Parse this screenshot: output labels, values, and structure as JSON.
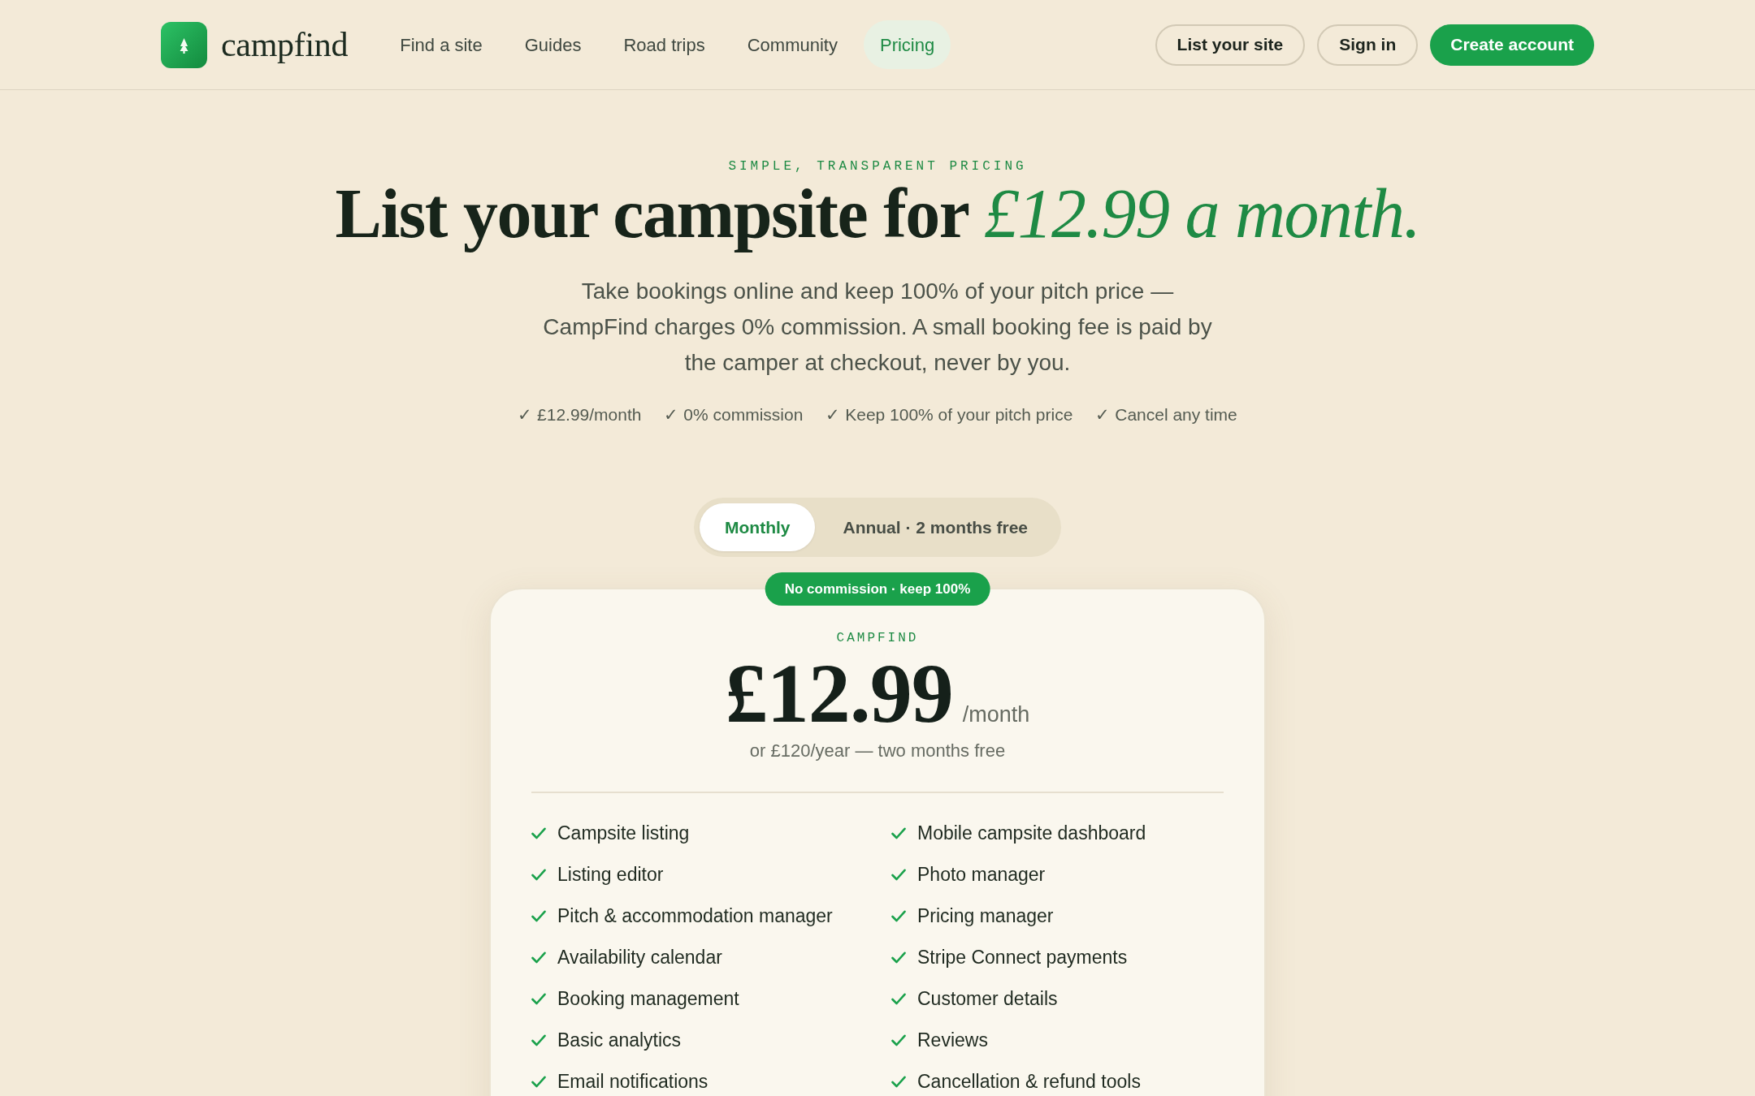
{
  "nav": {
    "logo": "campfind",
    "links": [
      {
        "label": "Find a site",
        "selected": false
      },
      {
        "label": "Guides",
        "selected": false
      },
      {
        "label": "Road trips",
        "selected": false
      },
      {
        "label": "Community",
        "selected": false
      },
      {
        "label": "Pricing",
        "selected": true
      }
    ],
    "actions": [
      {
        "label": "List your site",
        "kind": "outline"
      },
      {
        "label": "Sign in",
        "kind": "outline"
      },
      {
        "label": "Create account",
        "kind": "primary"
      }
    ]
  },
  "hero": {
    "eyebrow": "SIMPLE, TRANSPARENT PRICING",
    "heading": "List your campsite for *£12.99 a month.*",
    "intro": "Take bookings online and keep 100% of your pitch price — CampFind charges 0% commission. A small booking fee is paid by the camper at checkout, never by you.",
    "highlights": [
      "✓ £12.99/month",
      "✓ 0% commission",
      "✓ Keep 100% of your pitch price",
      "✓ Cancel any time"
    ]
  },
  "billing_toggle": [
    {
      "label": "Monthly",
      "selected": true
    },
    {
      "label": "Annual · 2 months free",
      "selected": false
    }
  ],
  "plan_card": {
    "badge": "No commission · keep 100%",
    "plan_name": "CAMPFIND",
    "price": "£12.99",
    "period": "/month",
    "alternative": "or £120/year — two months free",
    "features": [
      "Campsite listing",
      "Mobile campsite dashboard",
      "Listing editor",
      "Photo manager",
      "Pitch & accommodation manager",
      "Pricing manager",
      "Availability calendar",
      "Stripe Connect payments",
      "Booking management",
      "Customer details",
      "Basic analytics",
      "Reviews",
      "Email notifications",
      "Cancellation & refund tools"
    ]
  }
}
